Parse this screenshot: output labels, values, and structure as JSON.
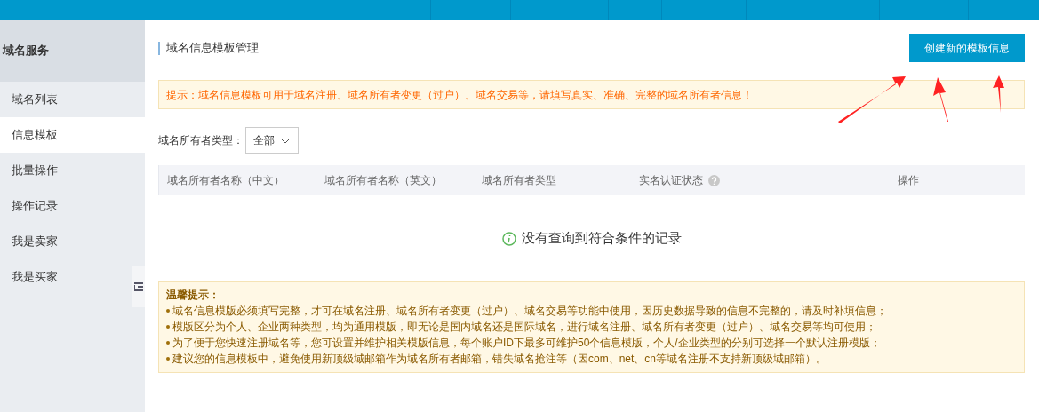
{
  "sidebar": {
    "title": "域名服务",
    "items": [
      {
        "label": "域名列表",
        "selected": false
      },
      {
        "label": "信息模板",
        "selected": true
      },
      {
        "label": "批量操作",
        "selected": false
      },
      {
        "label": "操作记录",
        "selected": false
      },
      {
        "label": "我是卖家",
        "selected": false
      },
      {
        "label": "我是买家",
        "selected": false
      }
    ]
  },
  "page": {
    "title": "域名信息模板管理",
    "create_button": "创建新的模板信息",
    "notice": "提示：域名信息模板可用于域名注册、域名所有者变更（过户）、域名交易等，请填写真实、准确、完整的域名所有者信息！",
    "filter": {
      "label": "域名所有者类型：",
      "value": "全部"
    },
    "table": {
      "columns": [
        {
          "label": "域名所有者名称（中文）",
          "help": false
        },
        {
          "label": "域名所有者名称（英文）",
          "help": false
        },
        {
          "label": "域名所有者类型",
          "help": false
        },
        {
          "label": "实名认证状态",
          "help": true
        },
        {
          "label": "操作",
          "help": false
        }
      ],
      "empty": "没有查询到符合条件的记录"
    },
    "tips": {
      "title": "温馨提示：",
      "items": [
        "域名信息模版必须填写完整，才可在域名注册、域名所有者变更（过户）、域名交易等功能中使用，因历史数据导致的信息不完整的，请及时补填信息；",
        "模版区分为个人、企业两种类型，均为通用模版，即无论是国内域名还是国际域名，进行域名注册、域名所有者变更（过户）、域名交易等均可使用；",
        "为了便于您快速注册域名等，您可设置并维护相关模版信息，每个账户ID下最多可维护50个信息模版，个人/企业类型的分别可选择一个默认注册模版；",
        "建议您的信息模板中，避免使用新顶级域邮箱作为域名所有者邮箱，错失域名抢注等（因com、net、cn等域名注册不支持新顶级域邮箱）。"
      ]
    }
  }
}
